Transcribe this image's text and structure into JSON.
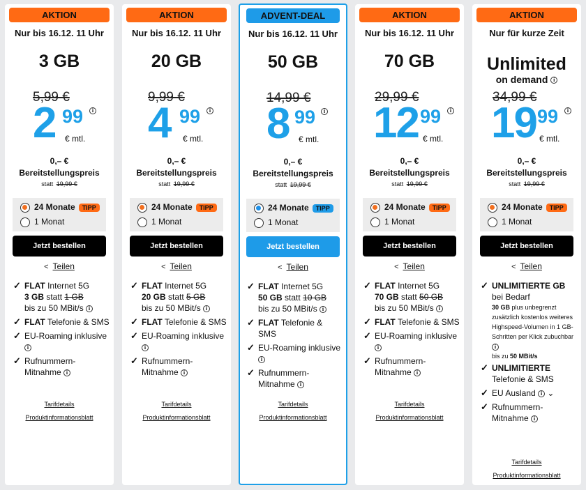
{
  "colors": {
    "orange": "#ff6a14",
    "blue": "#1e9be8",
    "price_blue": "#1ea0e8"
  },
  "cards": [
    {
      "badge": "AKTION",
      "validity": "Nur bis 16.12. 11 Uhr",
      "data": "3 GB",
      "old_price": "5,99 €",
      "price_int": "2",
      "price_cents": "99",
      "per_month": "€ mtl.",
      "setup_price": "0,– €",
      "setup_label": "Bereitstellungspreis",
      "setup_old_prefix": "statt",
      "setup_old": "19,99 €",
      "opt_24": "24 Monate",
      "tipp": "TIPP",
      "opt_1": "1 Monat",
      "order": "Jetzt bestellen",
      "share": "Teilen",
      "f1_bold": "FLAT",
      "f1_text": " Internet 5G",
      "f1_gb": "3 GB",
      "f1_statt": " statt ",
      "f1_old": "1 GB",
      "f1_speed": "bis zu 50 MBit/s",
      "f2_bold": "FLAT",
      "f2_text": " Telefonie & SMS",
      "f3_text": "EU-Roaming inklusive",
      "f4_text": "Rufnummern-Mitnahme",
      "tarif": "Tarifdetails",
      "pib": "Produktinformationsblatt"
    },
    {
      "badge": "AKTION",
      "validity": "Nur bis 16.12. 11 Uhr",
      "data": "20 GB",
      "old_price": "9,99 €",
      "price_int": "4",
      "price_cents": "99",
      "per_month": "€ mtl.",
      "setup_price": "0,– €",
      "setup_label": "Bereitstellungspreis",
      "setup_old_prefix": "statt",
      "setup_old": "19,99 €",
      "opt_24": "24 Monate",
      "tipp": "TIPP",
      "opt_1": "1 Monat",
      "order": "Jetzt bestellen",
      "share": "Teilen",
      "f1_bold": "FLAT",
      "f1_text": " Internet 5G",
      "f1_gb": "20 GB",
      "f1_statt": " statt ",
      "f1_old": "5 GB",
      "f1_speed": "bis zu 50 MBit/s",
      "f2_bold": "FLAT",
      "f2_text": " Telefonie & SMS",
      "f3_text": "EU-Roaming inklusive",
      "f4_text": "Rufnummern-Mitnahme",
      "tarif": "Tarifdetails",
      "pib": "Produktinformationsblatt"
    },
    {
      "badge": "ADVENT-DEAL",
      "validity": "Nur bis 16.12. 11 Uhr",
      "data": "50 GB",
      "old_price": "14,99 €",
      "price_int": "8",
      "price_cents": "99",
      "per_month": "€ mtl.",
      "setup_price": "0,– €",
      "setup_label": "Bereitstellungspreis",
      "setup_old_prefix": "statt",
      "setup_old": "19,99 €",
      "opt_24": "24 Monate",
      "tipp": "TIPP",
      "opt_1": "1 Monat",
      "order": "Jetzt bestellen",
      "share": "Teilen",
      "f1_bold": "FLAT",
      "f1_text": " Internet 5G",
      "f1_gb": "50 GB",
      "f1_statt": " statt ",
      "f1_old": "10 GB",
      "f1_speed": "bis zu 50 MBit/s",
      "f2_bold": "FLAT",
      "f2_text": " Telefonie & SMS",
      "f3_text": "EU-Roaming inklusive",
      "f4_text": "Rufnummern-Mitnahme",
      "tarif": "Tarifdetails",
      "pib": "Produktinformationsblatt"
    },
    {
      "badge": "AKTION",
      "validity": "Nur bis 16.12. 11 Uhr",
      "data": "70 GB",
      "old_price": "29,99 €",
      "price_int": "12",
      "price_cents": "99",
      "per_month": "€ mtl.",
      "setup_price": "0,– €",
      "setup_label": "Bereitstellungspreis",
      "setup_old_prefix": "statt",
      "setup_old": "19,99 €",
      "opt_24": "24 Monate",
      "tipp": "TIPP",
      "opt_1": "1 Monat",
      "order": "Jetzt bestellen",
      "share": "Teilen",
      "f1_bold": "FLAT",
      "f1_text": " Internet 5G",
      "f1_gb": "70 GB",
      "f1_statt": " statt ",
      "f1_old": "50 GB",
      "f1_speed": "bis zu 50 MBit/s",
      "f2_bold": "FLAT",
      "f2_text": " Telefonie & SMS",
      "f3_text": "EU-Roaming inklusive",
      "f4_text": "Rufnummern-Mitnahme",
      "tarif": "Tarifdetails",
      "pib": "Produktinformationsblatt"
    },
    {
      "badge": "AKTION",
      "validity": "Nur für kurze Zeit",
      "data": "Unlimited",
      "on_demand": "on demand",
      "old_price": "34,99 €",
      "price_int": "19",
      "price_cents": "99",
      "per_month": "€ mtl.",
      "setup_price": "0,– €",
      "setup_label": "Bereitstellungspreis",
      "setup_old_prefix": "statt",
      "setup_old": "19,99 €",
      "opt_24": "24 Monate",
      "tipp": "TIPP",
      "opt_1": "1 Monat",
      "order": "Jetzt bestellen",
      "share": "Teilen",
      "u1_bold": "UNLIMITIERTE GB",
      "u1_text": "bei Bedarf",
      "u1_small_a": "30 GB",
      "u1_small_b": " plus unbegrenzt zusätzlich kostenlos weiteres Highspeed-Volumen in 1 GB-Schritten per Klick zubuchbar",
      "u1_small_c": "bis zu ",
      "u1_small_d": "50 MBit/s",
      "u2_bold": "UNLIMITIERTE",
      "u2_text": "Telefonie & SMS",
      "u3_text": "EU Ausland",
      "u4_text": "Rufnummern-Mitnahme",
      "tarif": "Tarifdetails",
      "pib": "Produktinformationsblatt"
    }
  ]
}
